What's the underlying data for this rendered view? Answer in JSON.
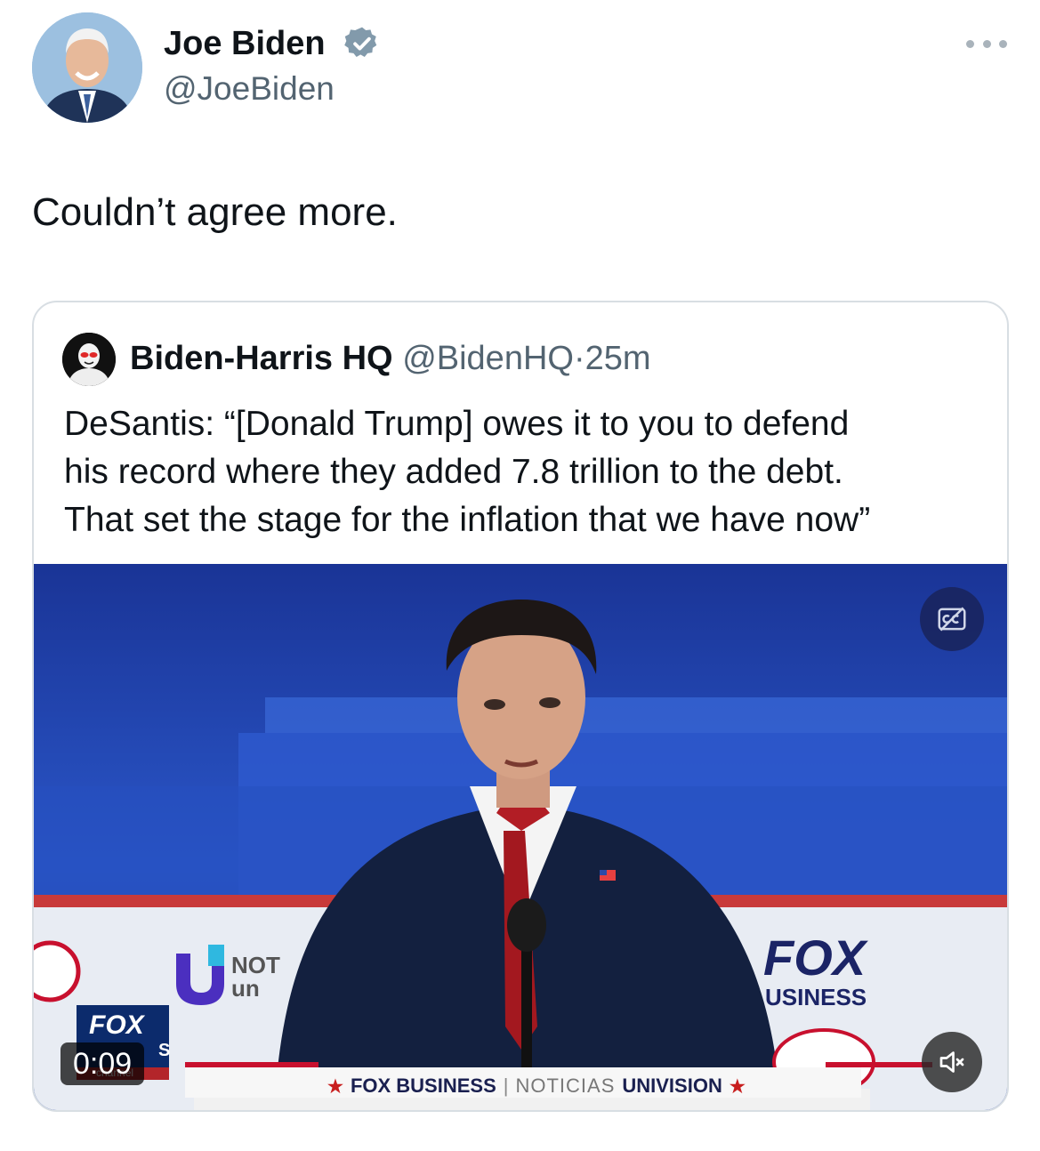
{
  "author": {
    "name": "Joe Biden",
    "handle": "@JoeBiden",
    "verified": true,
    "badge_color": "#829aab"
  },
  "tweet": {
    "text": "Couldn’t agree more."
  },
  "quote": {
    "name": "Biden-Harris HQ",
    "handle": "@BidenHQ",
    "separator": "·",
    "time": "25m",
    "text_lines": [
      "DeSantis: “[Donald Trump] owes it to you to defend",
      "his record where they added 7.8 trillion to the debt.",
      "That set the stage for the inflation that we have now”"
    ]
  },
  "video": {
    "timestamp": "0:09",
    "cc_icon": "closed-captions-icon",
    "mute_icon": "muted-speaker-icon",
    "overlay_text": {
      "fox_bug_top": "FOX",
      "fox_bug_bottom": "S",
      "fox_bug_channel": "channel",
      "univision_fragment_1": "NOT",
      "univision_fragment_2": "un",
      "fox_business_fragment_1": "FOX",
      "fox_business_fragment_2": "USINESS",
      "ticker_fox": "FOX BUSINESS",
      "ticker_divider": "|",
      "ticker_noticias": "NOTICIAS",
      "ticker_univision": "UNIVISION",
      "ticker_star": "★"
    }
  },
  "colors": {
    "text_primary": "#0f1419",
    "text_secondary": "#536471",
    "border": "#d8dee3",
    "stage_blue": "#1f3fa8"
  }
}
